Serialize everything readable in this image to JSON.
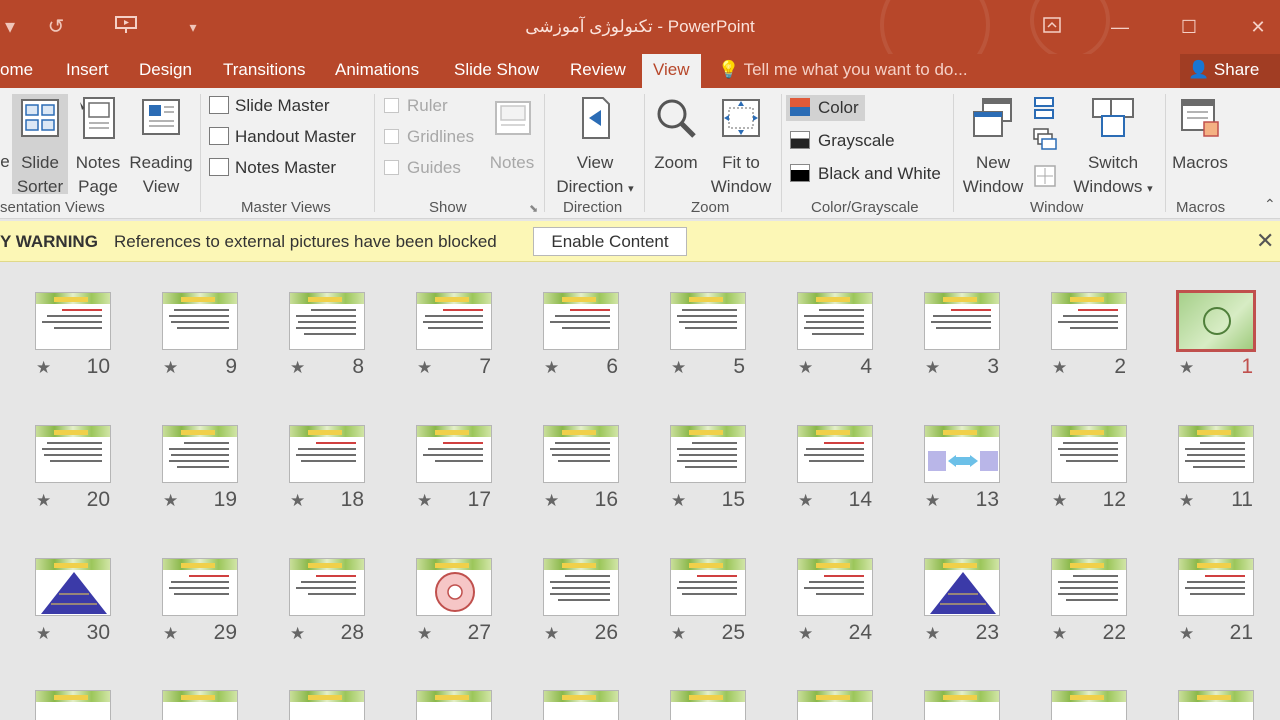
{
  "window": {
    "title": "تکنولوژی آموزشی - PowerPoint",
    "undo_icon": "undo-icon",
    "present_icon": "present-from-beginning-icon",
    "qat_dropdown": "▾",
    "controls": [
      "ribbon-display-options-icon",
      "minimize-icon",
      "maximize-icon",
      "close-icon"
    ]
  },
  "tabs": [
    "ome",
    "Insert",
    "Design",
    "Transitions",
    "Animations",
    "Slide Show",
    "Review",
    "View"
  ],
  "tell_me": "Tell me what you want to do...",
  "share": "Share",
  "ribbon": {
    "groups": {
      "presentation_views": "sentation Views",
      "master_views": "Master Views",
      "show": "Show",
      "direction": "Direction",
      "zoom": "Zoom",
      "color": "Color/Grayscale",
      "window": "Window",
      "macros": "Macros"
    },
    "buttons": {
      "normal_partial": "e",
      "slide_sorter": [
        "Slide",
        "Sorter"
      ],
      "notes_page": [
        "Notes",
        "Page"
      ],
      "reading_view": [
        "Reading",
        "View"
      ],
      "slide_master": "Slide Master",
      "handout_master": "Handout Master",
      "notes_master": "Notes Master",
      "ruler": "Ruler",
      "gridlines": "Gridlines",
      "guides": "Guides",
      "notes": "Notes",
      "view_direction": [
        "View",
        "Direction"
      ],
      "zoom": "Zoom",
      "fit_to_window": [
        "Fit to",
        "Window"
      ],
      "color": "Color",
      "grayscale": "Grayscale",
      "black_and_white": "Black and White",
      "new_window": [
        "New",
        "Window"
      ],
      "switch_windows": [
        "Switch",
        "Windows"
      ],
      "macros": "Macros"
    }
  },
  "warning": {
    "title": "Y WARNING",
    "message": "References to external pictures have been blocked",
    "button": "Enable Content"
  },
  "slides": {
    "row1": [
      "10",
      "9",
      "8",
      "7",
      "6",
      "5",
      "4",
      "3",
      "2",
      "1"
    ],
    "row2": [
      "20",
      "19",
      "18",
      "17",
      "16",
      "15",
      "14",
      "13",
      "12",
      "11"
    ],
    "row3": [
      "30",
      "29",
      "28",
      "27",
      "26",
      "25",
      "24",
      "23",
      "22",
      "21"
    ],
    "selected": "1"
  },
  "colors": {
    "accent": "#b7472a",
    "selection": "#c0504d"
  }
}
